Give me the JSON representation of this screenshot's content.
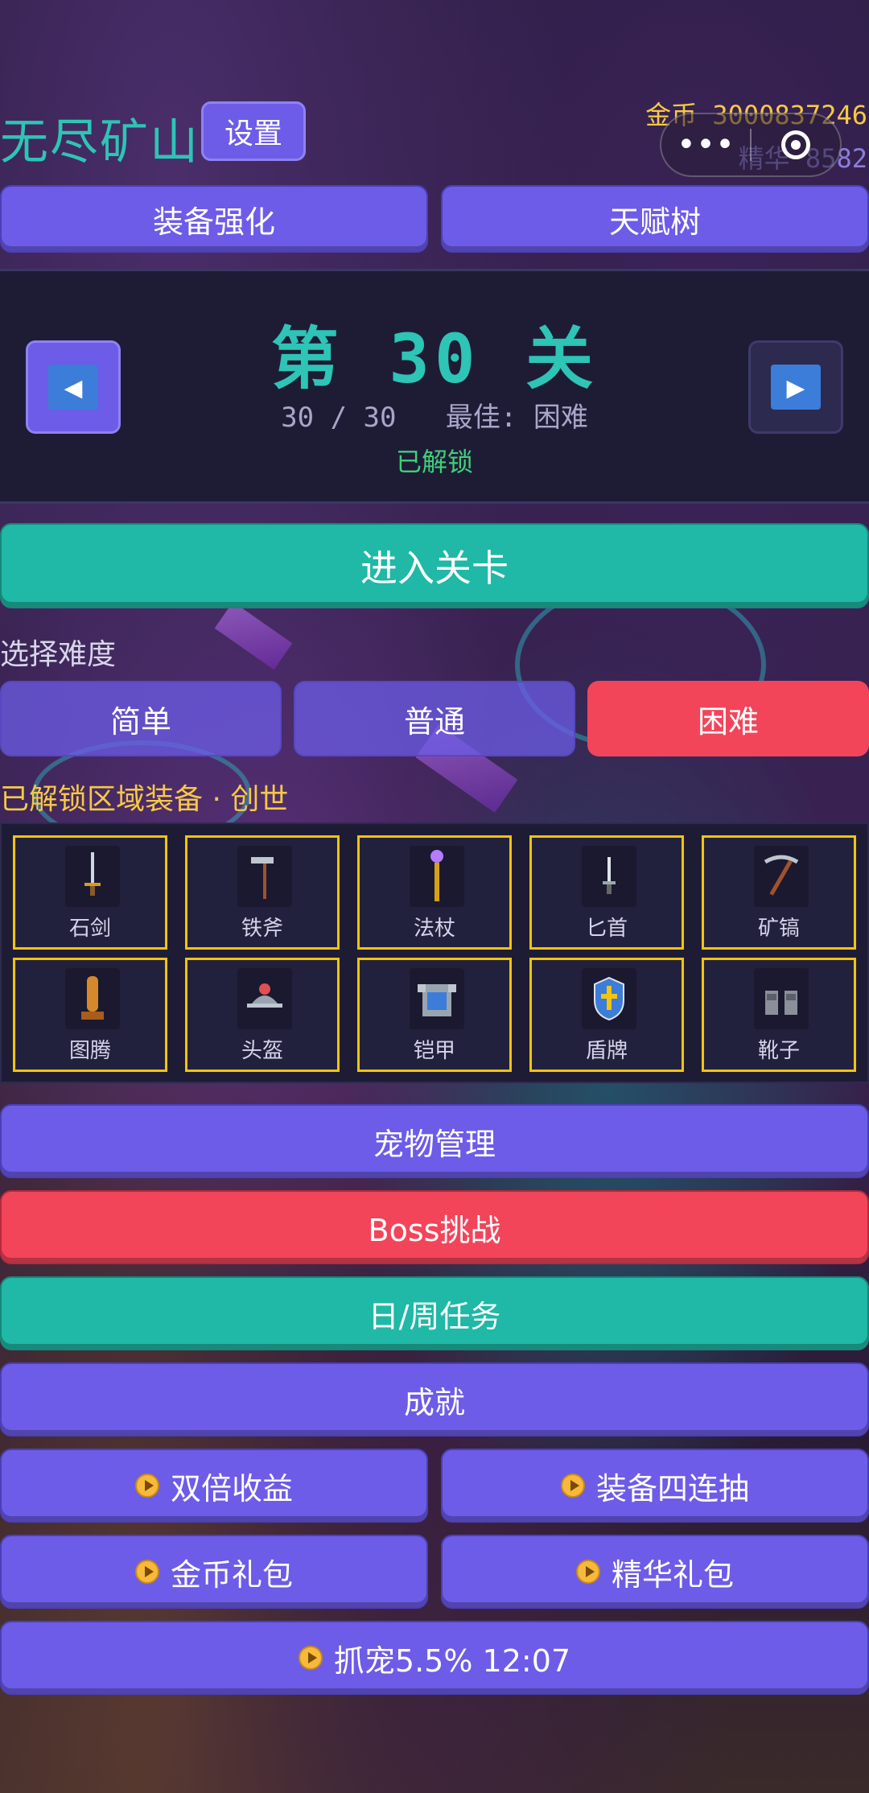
{
  "header": {
    "title": "无尽矿山",
    "settings_label": "设置",
    "gold_text": "金币 3000837246",
    "essence_text": "精华 8582"
  },
  "capsule": {
    "menu_icon": "more-dots-icon",
    "close_icon": "target-circle-icon"
  },
  "top_buttons": {
    "enhance": "装备强化",
    "talent": "天赋树"
  },
  "level": {
    "title": "第 30 关",
    "progress": "30 / 30",
    "best": "最佳: 困难",
    "status": "已解锁",
    "prev_icon": "◀",
    "next_icon": "▶"
  },
  "enter_label": "进入关卡",
  "difficulty": {
    "label": "选择难度",
    "options": [
      "简单",
      "普通",
      "困难"
    ],
    "selected": "困难"
  },
  "equipment": {
    "label": "已解锁区域装备 · 创世",
    "items": [
      {
        "name": "石剑",
        "icon": "sword-icon"
      },
      {
        "name": "铁斧",
        "icon": "axe-icon"
      },
      {
        "name": "法杖",
        "icon": "staff-icon"
      },
      {
        "name": "匕首",
        "icon": "dagger-icon"
      },
      {
        "name": "矿镐",
        "icon": "pickaxe-icon"
      },
      {
        "name": "图腾",
        "icon": "totem-icon"
      },
      {
        "name": "头盔",
        "icon": "helmet-icon"
      },
      {
        "name": "铠甲",
        "icon": "armor-icon"
      },
      {
        "name": "盾牌",
        "icon": "shield-icon"
      },
      {
        "name": "靴子",
        "icon": "boots-icon"
      }
    ]
  },
  "menu": {
    "pets": "宠物管理",
    "boss": "Boss挑战",
    "tasks": "日/周任务",
    "achievements": "成就",
    "double_income": "双倍收益",
    "four_draw": "装备四连抽",
    "gold_pack": "金币礼包",
    "essence_pack": "精华礼包",
    "catch_pet": "抓宠5.5% 12:07"
  },
  "colors": {
    "accent_purple": "#6c5ce7",
    "teal": "#20b8a6",
    "red": "#f2455a",
    "gold": "#f6c945",
    "yellow_border": "#f1c40f"
  }
}
